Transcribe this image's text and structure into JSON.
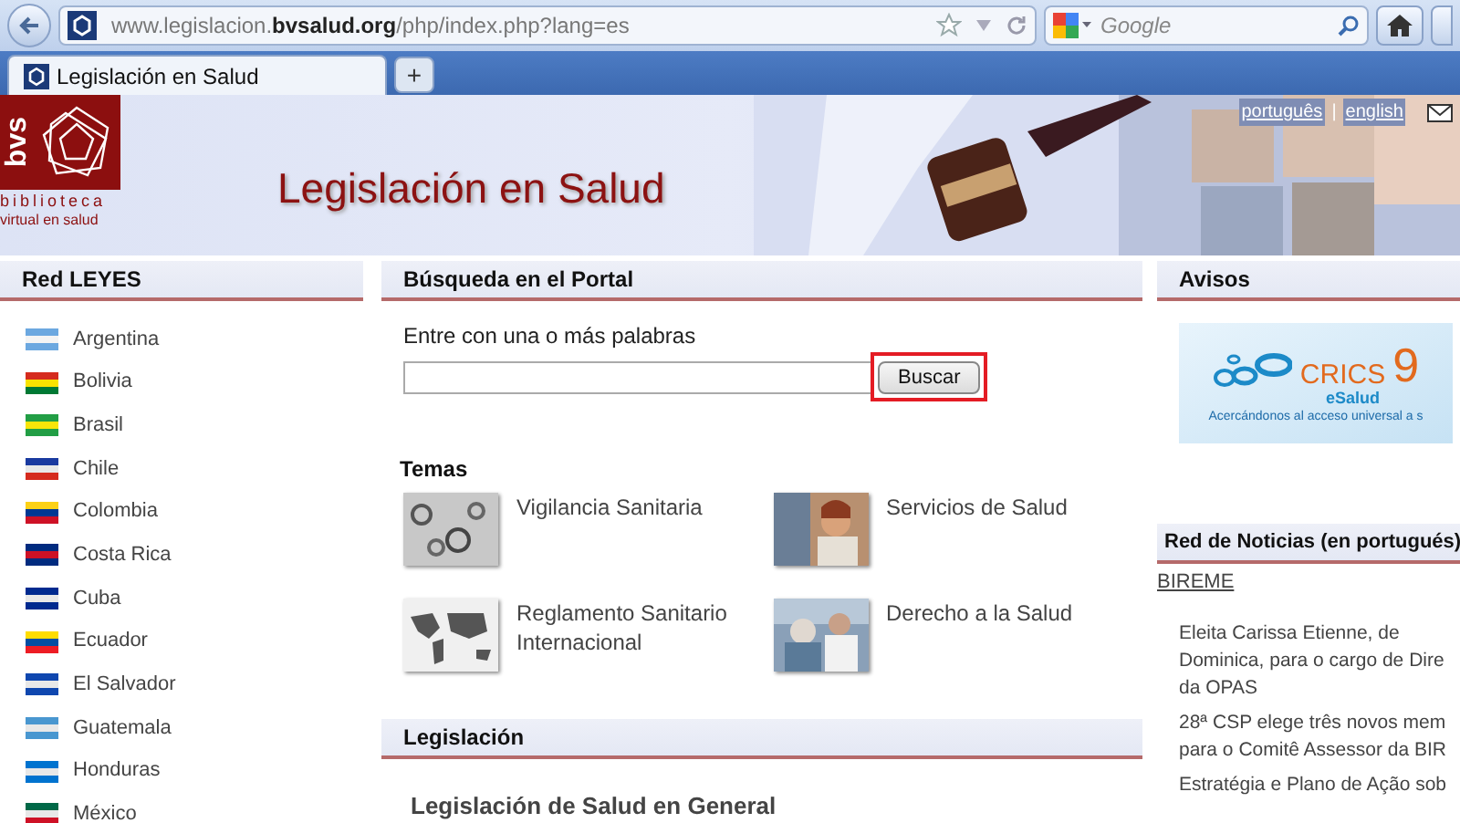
{
  "browser": {
    "url": "www.legislacion.**bvsalud.org**/php/index.php?lang=es",
    "search": {
      "placeholder": "Google"
    },
    "tabs": [
      {
        "label": "Legislación en Salud",
        "selected": true
      }
    ],
    "new_tab": "+"
  },
  "header": {
    "logo": {
      "acronym": "bvs",
      "line1": "biblioteca",
      "line2": "virtual en salud"
    },
    "title": "Legislación en Salud",
    "languages": [
      {
        "label": "português"
      },
      {
        "label": "english"
      }
    ],
    "separator": "|"
  },
  "left": {
    "title": "Red LEYES",
    "countries": [
      {
        "name": "Argentina"
      },
      {
        "name": "Bolivia"
      },
      {
        "name": "Brasil"
      },
      {
        "name": "Chile"
      },
      {
        "name": "Colombia"
      },
      {
        "name": "Costa Rica"
      },
      {
        "name": "Cuba"
      },
      {
        "name": "Ecuador"
      },
      {
        "name": "El Salvador"
      },
      {
        "name": "Guatemala"
      },
      {
        "name": "Honduras"
      },
      {
        "name": "México"
      }
    ]
  },
  "middle": {
    "search": {
      "title": "Búsqueda en el Portal",
      "label": "Entre con una o más palabras",
      "button": "Buscar",
      "highlighted": true
    },
    "topics_title": "Temas",
    "topics": [
      {
        "label": "Vigilancia Sanitaria"
      },
      {
        "label": "Servicios de Salud"
      },
      {
        "label": "Reglamento Sanitario Internacional"
      },
      {
        "label": "Derecho a la Salud"
      }
    ],
    "legislation": {
      "title": "Legislación",
      "items": [
        {
          "label": "Legislación de Salud en General"
        }
      ]
    }
  },
  "right": {
    "title": "Avisos",
    "banner": {
      "brand": "CRICS",
      "number": "9",
      "sub": "eSalud",
      "tagline": "Acercándonos al acceso universal a s"
    },
    "news": {
      "title": "Red de Noticias (en portugués)",
      "source": "BIREME",
      "items": [
        {
          "lines": [
            "Eleita Carissa Etienne, de",
            "Dominica, para o cargo de Dire",
            "da OPAS"
          ]
        },
        {
          "lines": [
            "28ª CSP elege três novos mem",
            "para o Comitê Assessor da BIR"
          ]
        },
        {
          "lines": [
            "Estratégia e Plano de Ação sob"
          ]
        }
      ]
    }
  }
}
